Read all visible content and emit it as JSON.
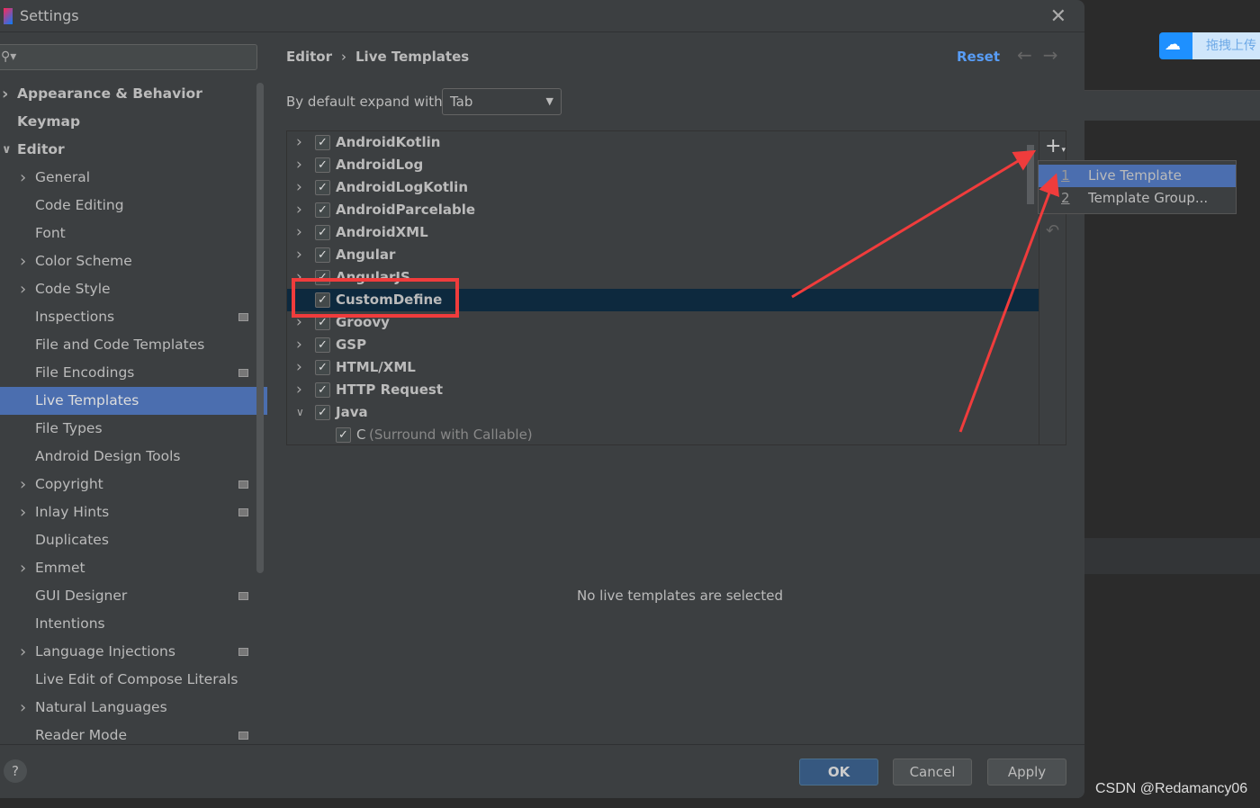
{
  "window": {
    "title": "Settings"
  },
  "sidebar": {
    "search_placeholder": "",
    "items": [
      {
        "label": "Appearance & Behavior",
        "level": 0,
        "chevron": "right",
        "bold": true
      },
      {
        "label": "Keymap",
        "level": 0,
        "bold": true
      },
      {
        "label": "Editor",
        "level": 0,
        "chevron": "down",
        "bold": true
      },
      {
        "label": "General",
        "level": 1,
        "chevron": "right"
      },
      {
        "label": "Code Editing",
        "level": 1
      },
      {
        "label": "Font",
        "level": 1
      },
      {
        "label": "Color Scheme",
        "level": 1,
        "chevron": "right"
      },
      {
        "label": "Code Style",
        "level": 1,
        "chevron": "right"
      },
      {
        "label": "Inspections",
        "level": 1,
        "badge": true
      },
      {
        "label": "File and Code Templates",
        "level": 1
      },
      {
        "label": "File Encodings",
        "level": 1,
        "badge": true
      },
      {
        "label": "Live Templates",
        "level": 1,
        "selected": true
      },
      {
        "label": "File Types",
        "level": 1
      },
      {
        "label": "Android Design Tools",
        "level": 1
      },
      {
        "label": "Copyright",
        "level": 1,
        "chevron": "right",
        "badge": true
      },
      {
        "label": "Inlay Hints",
        "level": 1,
        "chevron": "right",
        "badge": true
      },
      {
        "label": "Duplicates",
        "level": 1
      },
      {
        "label": "Emmet",
        "level": 1,
        "chevron": "right"
      },
      {
        "label": "GUI Designer",
        "level": 1,
        "badge": true
      },
      {
        "label": "Intentions",
        "level": 1
      },
      {
        "label": "Language Injections",
        "level": 1,
        "chevron": "right",
        "badge": true
      },
      {
        "label": "Live Edit of Compose Literals",
        "level": 1
      },
      {
        "label": "Natural Languages",
        "level": 1,
        "chevron": "right"
      },
      {
        "label": "Reader Mode",
        "level": 1,
        "badge": true
      }
    ]
  },
  "main": {
    "breadcrumb": [
      "Editor",
      "Live Templates"
    ],
    "reset_label": "Reset",
    "expand_label": "By default expand with",
    "expand_value": "Tab",
    "templates": [
      {
        "label": "AndroidKotlin",
        "checked": true,
        "chevron": "right"
      },
      {
        "label": "AndroidLog",
        "checked": true,
        "chevron": "right"
      },
      {
        "label": "AndroidLogKotlin",
        "checked": true,
        "chevron": "right"
      },
      {
        "label": "AndroidParcelable",
        "checked": true,
        "chevron": "right"
      },
      {
        "label": "AndroidXML",
        "checked": true,
        "chevron": "right"
      },
      {
        "label": "Angular",
        "checked": true,
        "chevron": "right"
      },
      {
        "label": "AngularJS",
        "checked": true,
        "chevron": "right"
      },
      {
        "label": "CustomDefine",
        "checked": true,
        "selected": true
      },
      {
        "label": "Groovy",
        "checked": true,
        "chevron": "right"
      },
      {
        "label": "GSP",
        "checked": true,
        "chevron": "right"
      },
      {
        "label": "HTML/XML",
        "checked": true,
        "chevron": "right"
      },
      {
        "label": "HTTP Request",
        "checked": true,
        "chevron": "right"
      },
      {
        "label": "Java",
        "checked": true,
        "chevron": "down"
      },
      {
        "label": "C",
        "description": "(Surround with Callable)",
        "checked": true,
        "child": true
      }
    ],
    "empty_message": "No live templates are selected"
  },
  "add_menu": {
    "items": [
      {
        "num": "1",
        "label": "Live Template",
        "selected": true
      },
      {
        "num": "2",
        "label": "Template Group..."
      }
    ]
  },
  "footer": {
    "help": "?",
    "ok": "OK",
    "cancel": "Cancel",
    "apply": "Apply"
  },
  "baidu": {
    "label": "拖拽上传"
  },
  "watermark": "CSDN @Redamancy06",
  "colors": {
    "annotation": "#f03c3c",
    "selection": "#4b6eaf",
    "accent": "#589df6"
  }
}
